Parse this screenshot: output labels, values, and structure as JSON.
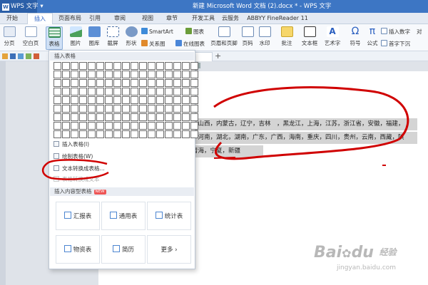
{
  "app": {
    "name": "WPS 文字",
    "logo": "W"
  },
  "window": {
    "title": "新建 Microsoft Word 文档 (2).docx * - WPS 文字"
  },
  "tabs": [
    "开始",
    "插入",
    "页面布局",
    "引用",
    "审阅",
    "视图",
    "章节",
    "开发工具",
    "云服务",
    "ABBYY FineReader 11"
  ],
  "ribbon": {
    "page_break": "分页",
    "blank_page": "空白页",
    "table": "表格",
    "picture": "图片",
    "gallery": "图库",
    "screenshot": "截屏",
    "shape": "形状",
    "smartart": "SmartArt",
    "relation": "关系图",
    "chart": "图表",
    "online_chart": "在线图表",
    "header_footer": "页眉和页脚",
    "page_number": "页码",
    "watermark": "水印",
    "comment": "批注",
    "textbox": "文本框",
    "wordart": "艺术字",
    "symbol": "符号",
    "formula": "公式",
    "insert_number": "插入数字",
    "dropcap": "首字下沉",
    "object": "对"
  },
  "dropdown": {
    "insert_table_header": "插入表格",
    "insert_table": "插入表格(I)",
    "draw_table": "绘制表格(W)",
    "text_to_table": "文本转换成表格...",
    "table_to_text": "表格转换成文本",
    "template_header": "插入内容型表格",
    "new_badge": "NEW",
    "templates": [
      "汇报表",
      "通用表",
      "统计表",
      "物资表",
      "简历",
      "更多"
    ],
    "more_chevron": "›"
  },
  "document": {
    "lines": [
      "，山西，内蒙古，辽宁，吉林　，黑龙江，上海，江苏，浙江省，安徽，福建，",
      "，河南，湖北，湖南，广东，广西，海南，重庆，四川，贵州，云南，西藏，陕",
      "青海，宁夏，新疆"
    ]
  },
  "watermark": {
    "brand": "Bai",
    "brand2": "du",
    "cn": "经验",
    "url": "jingyan.baidu.com"
  },
  "colors": {
    "accent": "#2c62c6",
    "titlebar": "#3d76c4",
    "annotation": "#d00000"
  }
}
